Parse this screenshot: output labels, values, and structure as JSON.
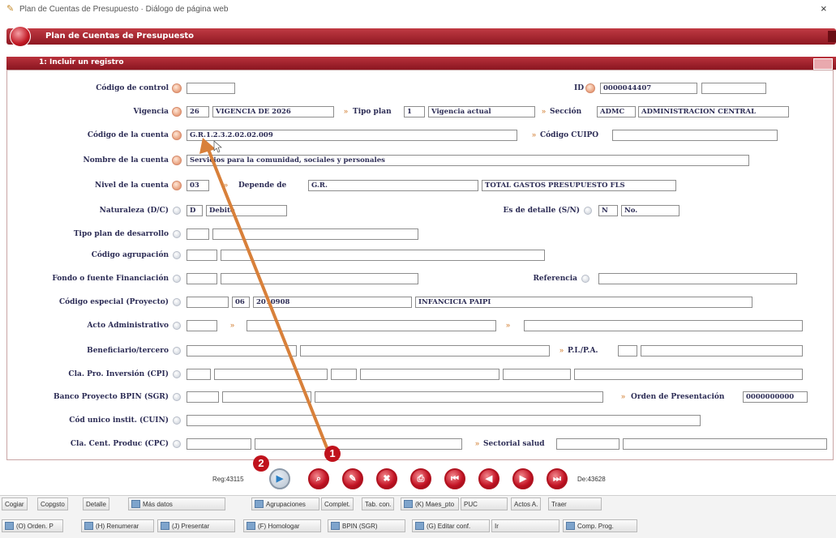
{
  "window": {
    "title": "Plan de Cuentas de Presupuesto · Diálogo de página web",
    "close": "×"
  },
  "header": {
    "title": "Plan de Cuentas de Presupuesto"
  },
  "subheader": {
    "title": "1: Incluir un registro"
  },
  "form": {
    "codigo_control": {
      "label": "Código de control",
      "value": ""
    },
    "id": {
      "label": "ID",
      "value": "0000044407",
      "extra": ""
    },
    "vigencia": {
      "label": "Vigencia",
      "code": "26",
      "value": "VIGENCIA DE 2026"
    },
    "tipo_plan": {
      "label": "Tipo plan",
      "code": "1",
      "value": "Vigencia actual"
    },
    "seccion": {
      "label": "Sección",
      "code": "ADMC",
      "value": "ADMINISTRACION CENTRAL"
    },
    "codigo_cuenta": {
      "label": "Código de la cuenta",
      "value": "G.R.1.2.3.2.02.02.009"
    },
    "codigo_cuipo": {
      "label": "Código CUIPO",
      "value": ""
    },
    "nombre_cuenta": {
      "label": "Nombre de la cuenta",
      "value": "Servicios para la comunidad, sociales y personales"
    },
    "nivel_cuenta": {
      "label": "Nivel de la cuenta",
      "value": "03"
    },
    "depende_de": {
      "label": "Depende de",
      "code": "G.R.",
      "value": "TOTAL GASTOS PRESUPUESTO FLS"
    },
    "naturaleza": {
      "label": "Naturaleza (D/C)",
      "code": "D",
      "value": "Debito"
    },
    "es_detalle": {
      "label": "Es de detalle (S/N)",
      "code": "N",
      "value": "No."
    },
    "tipo_plan_desarrollo": {
      "label": "Tipo plan de desarrollo"
    },
    "codigo_agrupacion": {
      "label": "Código agrupación"
    },
    "fondo_fuente": {
      "label": "Fondo o fuente Financiación"
    },
    "referencia": {
      "label": "Referencia"
    },
    "codigo_especial": {
      "label": "Código especial (Proyecto)",
      "code": "06",
      "code2": "2010908",
      "value": "INFANCICIA PAIPI"
    },
    "acto_administrativo": {
      "label": "Acto Administrativo"
    },
    "beneficiario": {
      "label": "Beneficiario/tercero"
    },
    "pi_pa": {
      "label": "P.I./P.A."
    },
    "cla_pro_inversion": {
      "label": "Cla. Pro. Inversión (CPI)"
    },
    "banco_proyecto": {
      "label": "Banco Proyecto BPIN (SGR)"
    },
    "orden_presentacion": {
      "label": "Orden de Presentación",
      "value": "0000000000"
    },
    "cod_unico": {
      "label": "Cód unico instit. (CUIN)"
    },
    "cla_cent_produc": {
      "label": "Cla. Cent. Produc (CPC)"
    },
    "sectorial_salud": {
      "label": "Sectorial salud"
    }
  },
  "nav": {
    "reg": "Reg:43115",
    "de": "De:43628",
    "badge1": "1",
    "badge2": "2"
  },
  "toolbar": {
    "row1": [
      "Cogiar",
      "Copgsto",
      "Detalle",
      "Más datos",
      "Agrupaciones",
      "Complet.",
      "Tab. con.",
      "(K) Maes_pto",
      "PUC",
      "Actos A.",
      "Traer"
    ],
    "row2": [
      "(O) Orden. P",
      "(H) Renumerar",
      "(J) Presentar",
      "(F) Homologar",
      "BPIN (SGR)",
      "(G) Editar conf.",
      "Ir",
      "Comp. Prog."
    ]
  }
}
